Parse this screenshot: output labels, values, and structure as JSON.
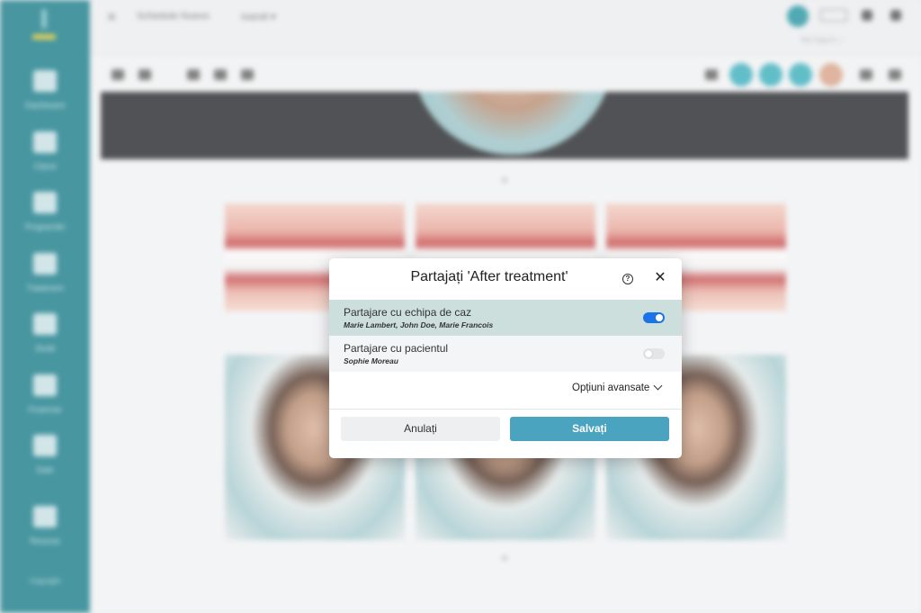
{
  "sidebar": {
    "items": [
      {
        "label": "Dashboard",
        "icon": "home-icon"
      },
      {
        "label": "Clienti",
        "icon": "clients-icon"
      },
      {
        "label": "Programări",
        "icon": "calendar-icon"
      },
      {
        "label": "Tratament",
        "icon": "treatment-icon"
      },
      {
        "label": "Studii",
        "icon": "studies-icon"
      },
      {
        "label": "Financiar",
        "icon": "chart-icon"
      },
      {
        "label": "Date",
        "icon": "data-icon"
      },
      {
        "label": "Resurse",
        "icon": "briefcase-icon"
      }
    ],
    "footer": "Copyright"
  },
  "topbar": {
    "menu_icon": "menu-icon",
    "crumb": "Schedule Nuevo",
    "case": "Ioandi ▾",
    "small": "Ver Caso ▾ ☆"
  },
  "modal": {
    "title": "Partajați 'After treatment'",
    "help_icon": "help-icon",
    "close_icon": "close-icon",
    "share_team": {
      "label": "Partajare cu echipa de caz",
      "members": "Marie Lambert, John Doe, Marie Francois",
      "enabled": true
    },
    "share_patient": {
      "label": "Partajare cu pacientul",
      "patient": "Sophie Moreau",
      "enabled": false
    },
    "advanced_label": "Opțiuni avansate",
    "cancel_label": "Anulați",
    "save_label": "Salvați"
  },
  "colors": {
    "sidebar": "#1f7f8c",
    "toggle_on": "#1a73e8",
    "save_button": "#4aa3bf",
    "active_row": "#cddfdc"
  }
}
